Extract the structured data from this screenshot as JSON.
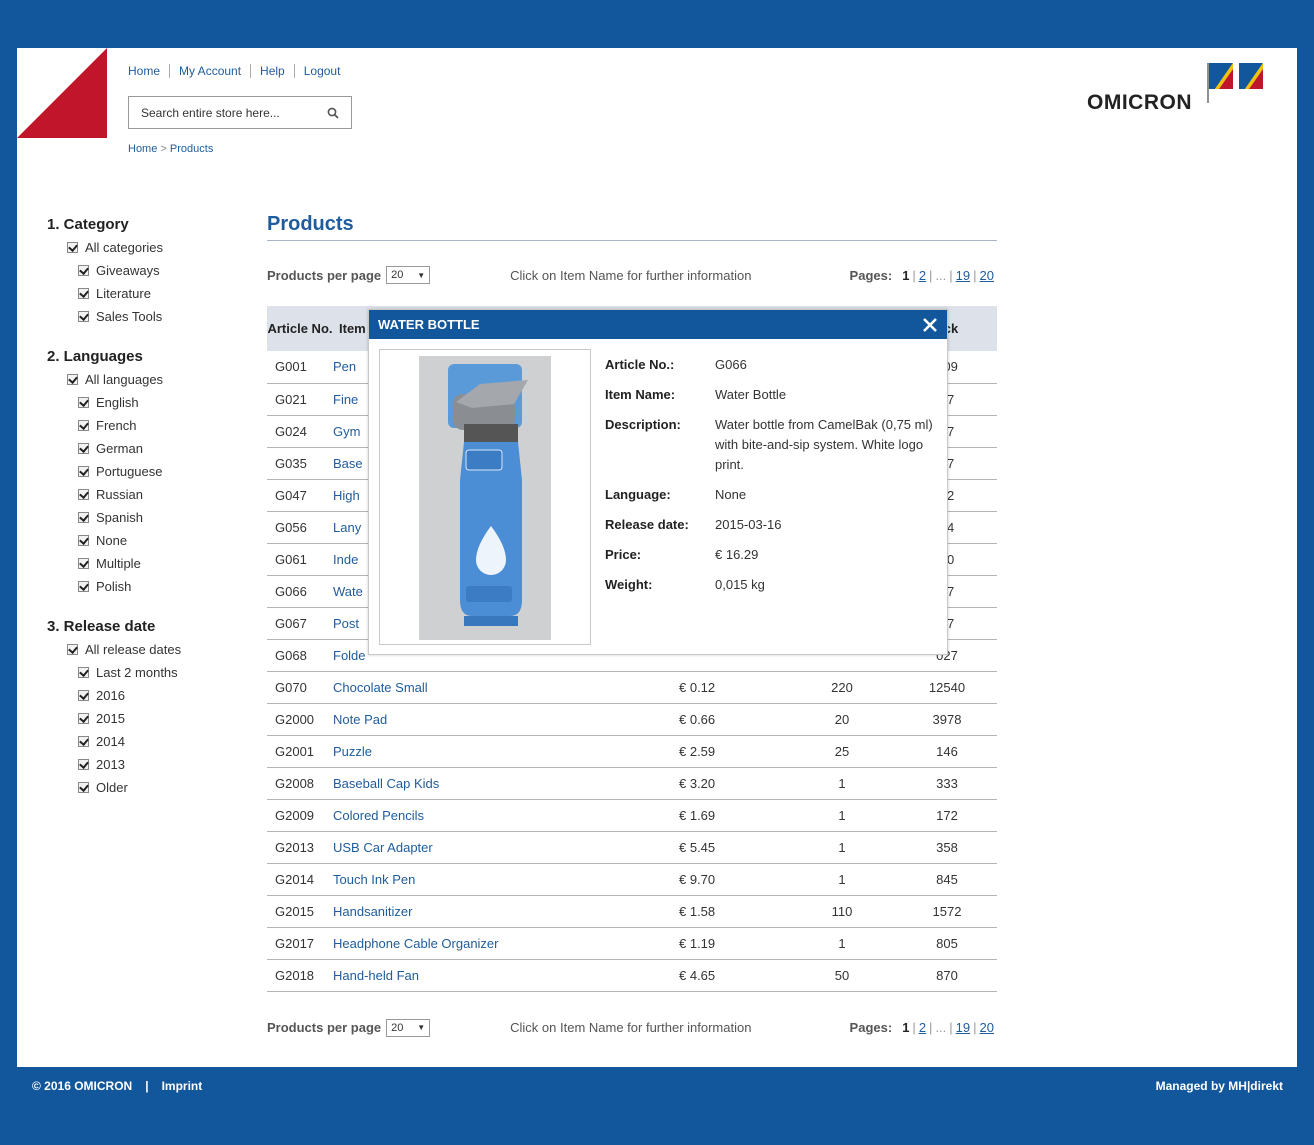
{
  "header": {
    "links": [
      "Home",
      "My Account",
      "Help",
      "Logout"
    ],
    "search_placeholder": "Search entire store here...",
    "breadcrumb": {
      "home": "Home",
      "sep": ">",
      "current": "Products"
    },
    "logo_text": "OMICRON",
    "brand_red": "#c0152a",
    "brand_blue": "#12569b"
  },
  "sidebar": {
    "category": {
      "title": "1. Category",
      "all": "All categories",
      "items": [
        "Giveaways",
        "Literature",
        "Sales Tools"
      ]
    },
    "languages": {
      "title": "2. Languages",
      "all": "All languages",
      "items": [
        "English",
        "French",
        "German",
        "Portuguese",
        "Russian",
        "Spanish",
        "None",
        "Multiple",
        "Polish"
      ]
    },
    "release": {
      "title": "3. Release date",
      "all": "All release dates",
      "items": [
        "Last 2 months",
        "2016",
        "2015",
        "2014",
        "2013",
        "Older"
      ]
    }
  },
  "main": {
    "title": "Products",
    "per_page_label": "Products per page",
    "per_page_value": "20",
    "info": "Click on Item Name for further information",
    "pages_label": "Pages:",
    "pages": {
      "current": "1",
      "p2": "2",
      "dots": "...",
      "p19": "19",
      "p20": "20"
    },
    "columns": {
      "article": "Article No.",
      "item": "Item",
      "stock": "ock"
    },
    "rows": [
      {
        "art": "G001",
        "name": "Pen",
        "price": "",
        "qty": "",
        "stock": "909"
      },
      {
        "art": "G021",
        "name": "Fine",
        "price": "",
        "qty": "",
        "stock": "67"
      },
      {
        "art": "G024",
        "name": "Gym",
        "price": "",
        "qty": "",
        "stock": "87"
      },
      {
        "art": "G035",
        "name": "Base",
        "price": "",
        "qty": "",
        "stock": "97"
      },
      {
        "art": "G047",
        "name": "High",
        "price": "",
        "qty": "",
        "stock": "02"
      },
      {
        "art": "G056",
        "name": "Lany",
        "price": "",
        "qty": "",
        "stock": "64"
      },
      {
        "art": "G061",
        "name": "Inde",
        "price": "",
        "qty": "",
        "stock": "90"
      },
      {
        "art": "G066",
        "name": "Wate",
        "price": "",
        "qty": "",
        "stock": "97"
      },
      {
        "art": "G067",
        "name": "Post",
        "price": "",
        "qty": "",
        "stock": "87"
      },
      {
        "art": "G068",
        "name": "Folde",
        "price": "",
        "qty": "",
        "stock": "027"
      },
      {
        "art": "G070",
        "name": "Chocolate Small",
        "price": "€ 0.12",
        "qty": "220",
        "stock": "12540"
      },
      {
        "art": "G2000",
        "name": "Note Pad",
        "price": "€ 0.66",
        "qty": "20",
        "stock": "3978"
      },
      {
        "art": "G2001",
        "name": "Puzzle",
        "price": "€ 2.59",
        "qty": "25",
        "stock": "146"
      },
      {
        "art": "G2008",
        "name": "Baseball Cap Kids",
        "price": "€ 3.20",
        "qty": "1",
        "stock": "333"
      },
      {
        "art": "G2009",
        "name": "Colored Pencils",
        "price": "€ 1.69",
        "qty": "1",
        "stock": "172"
      },
      {
        "art": "G2013",
        "name": "USB Car Adapter",
        "price": "€ 5.45",
        "qty": "1",
        "stock": "358"
      },
      {
        "art": "G2014",
        "name": "Touch Ink Pen",
        "price": "€ 9.70",
        "qty": "1",
        "stock": "845"
      },
      {
        "art": "G2015",
        "name": "Handsanitizer",
        "price": "€ 1.58",
        "qty": "110",
        "stock": "1572"
      },
      {
        "art": "G2017",
        "name": "Headphone Cable Organizer",
        "price": "€ 1.19",
        "qty": "1",
        "stock": "805"
      },
      {
        "art": "G2018",
        "name": "Hand-held Fan",
        "price": "€ 4.65",
        "qty": "50",
        "stock": "870"
      }
    ]
  },
  "modal": {
    "title": "WATER BOTTLE",
    "fields": [
      {
        "k": "Article No.:",
        "v": "G066"
      },
      {
        "k": "Item Name:",
        "v": "Water Bottle"
      },
      {
        "k": "Description:",
        "v": "Water bottle from CamelBak (0,75 ml) with bite-and-sip system. White logo print."
      },
      {
        "k": "Language:",
        "v": "None"
      },
      {
        "k": "Release date:",
        "v": "2015-03-16"
      },
      {
        "k": "Price:",
        "v": "€ 16.29"
      },
      {
        "k": "Weight:",
        "v": "0,015 kg"
      }
    ]
  },
  "footer": {
    "copyright": "© 2016 OMICRON",
    "sep": "|",
    "imprint": "Imprint",
    "managed": "Managed by MH|direkt"
  }
}
